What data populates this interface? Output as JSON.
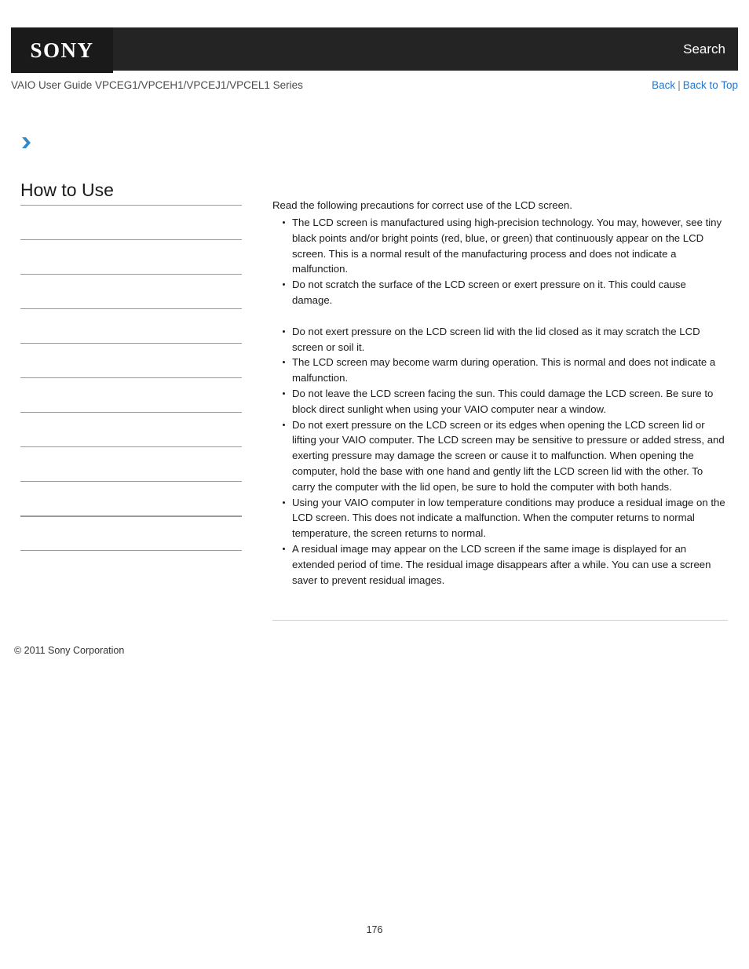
{
  "header": {
    "logo_text": "SONY",
    "search_label": "Search",
    "logo_block_color": "#1a1a1a",
    "bar_color": "#242424"
  },
  "subheader": {
    "guide_title": "VAIO User Guide VPCEG1/VPCEH1/VPCEJ1/VPCEL1 Series",
    "back_label": "Back",
    "separator": "|",
    "back_to_top_label": "Back to Top",
    "link_color": "#2277cc"
  },
  "breadcrumb": {
    "chevron_icon": "chevron-right-icon",
    "chevron_color": "#3389c6"
  },
  "sidebar": {
    "title": "How to Use",
    "items": [
      {
        "label": ""
      },
      {
        "label": ""
      },
      {
        "label": ""
      },
      {
        "label": ""
      },
      {
        "label": ""
      },
      {
        "label": ""
      },
      {
        "label": ""
      },
      {
        "label": ""
      },
      {
        "label": ""
      },
      {
        "label": ""
      },
      {
        "label": ""
      }
    ]
  },
  "main": {
    "intro": "Read the following precautions for correct use of the LCD screen.",
    "bullets": [
      "The LCD screen is manufactured using high-precision technology. You may, however, see tiny black points and/or bright points (red, blue, or green) that continuously appear on the LCD screen. This is a normal result of the manufacturing process and does not indicate a malfunction.",
      "Do not scratch the surface of the LCD screen or exert pressure on it. This could cause damage.",
      "Do not exert pressure on the LCD screen lid with the lid closed as it may scratch the LCD screen or soil it.",
      "The LCD screen may become warm during operation. This is normal and does not indicate a malfunction.",
      "Do not leave the LCD screen facing the sun. This could damage the LCD screen. Be sure to block direct sunlight when using your VAIO computer near a window.",
      "Do not exert pressure on the LCD screen or its edges when opening the LCD screen lid or lifting your VAIO computer. The LCD screen may be sensitive to pressure or added stress, and exerting pressure may damage the screen or cause it to malfunction. When opening the computer, hold the base with one hand and gently lift the LCD screen lid with the other. To carry the computer with the lid open, be sure to hold the computer with both hands.",
      "Using your VAIO computer in low temperature conditions may produce a residual image on the LCD screen. This does not indicate a malfunction. When the computer returns to normal temperature, the screen returns to normal.",
      "A residual image may appear on the LCD screen if the same image is displayed for an extended period of time. The residual image disappears after a while. You can use a screen saver to prevent residual images."
    ]
  },
  "footer": {
    "copyright": "© 2011 Sony Corporation",
    "page_number": "176"
  }
}
